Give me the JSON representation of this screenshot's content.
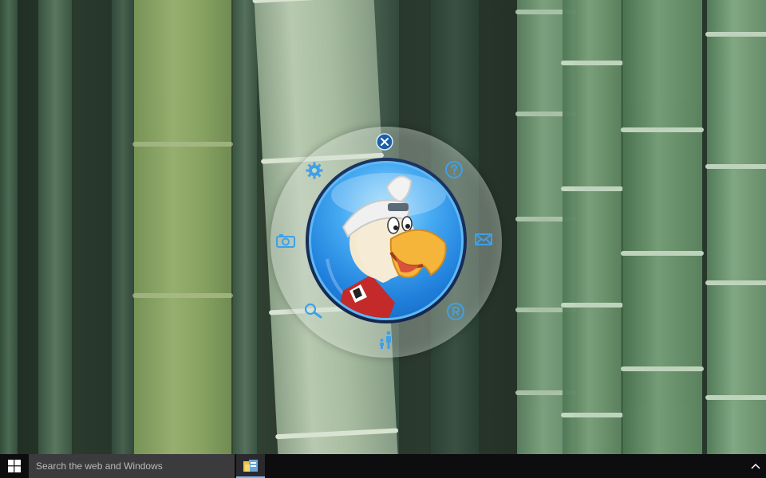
{
  "desktop": {
    "background": "bamboo-forest-wallpaper"
  },
  "widget": {
    "mascot": "eagle-mascot-with-helmet",
    "accent_color": "#3fa0e8",
    "ring_buttons": [
      {
        "name": "close-icon"
      },
      {
        "name": "help-icon"
      },
      {
        "name": "mail-icon"
      },
      {
        "name": "registered-icon"
      },
      {
        "name": "family-icon"
      },
      {
        "name": "search-icon"
      },
      {
        "name": "camera-icon"
      },
      {
        "name": "gear-icon"
      }
    ]
  },
  "taskbar": {
    "search_placeholder": "Search the web and Windows",
    "start_icon": "windows-logo-icon",
    "pinned_app_icon": "file-explorer-icon",
    "tray_icon": "chevron-up-icon",
    "accent_color": "#76b9ed"
  }
}
